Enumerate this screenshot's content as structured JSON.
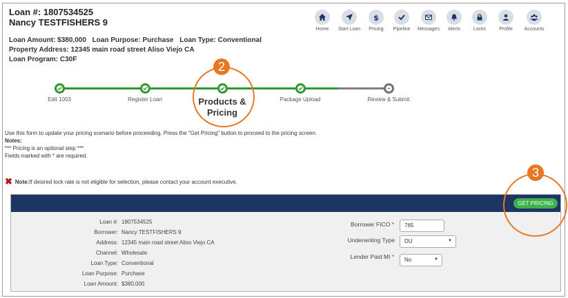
{
  "loan": {
    "number_line": "Loan #: 1807534525",
    "borrower_line": "Nancy TESTFISHERS 9",
    "amount_label": "Loan Amount: $380,000",
    "purpose_label": "Loan Purpose: Purchase",
    "type_label": "Loan Type: Conventional",
    "address_label": "Property Address: 12345 main road street Aliso Viejo CA",
    "program_label": "Loan Program: C30F"
  },
  "nav": [
    {
      "label": "Home",
      "icon": "home-icon"
    },
    {
      "label": "Start Loan",
      "icon": "arrow-icon"
    },
    {
      "label": "Pricing",
      "icon": "dollar-icon"
    },
    {
      "label": "Pipeline",
      "icon": "check-icon"
    },
    {
      "label": "Messages",
      "icon": "envelope-icon"
    },
    {
      "label": "Alerts",
      "icon": "bell-icon"
    },
    {
      "label": "Locks",
      "icon": "lock-icon"
    },
    {
      "label": "Profile",
      "icon": "user-icon"
    },
    {
      "label": "Accounts",
      "icon": "users-icon"
    }
  ],
  "steps": [
    {
      "label": "Edit 1003",
      "status": "complete"
    },
    {
      "label": "Register Loan",
      "status": "complete"
    },
    {
      "label": "Products & Pricing",
      "status": "current"
    },
    {
      "label": "Package Upload",
      "status": "complete"
    },
    {
      "label": "Review & Submit",
      "status": "pending"
    }
  ],
  "annotations": {
    "badge_2": "2",
    "badge_3": "3"
  },
  "info": {
    "instruction": "Use this form to update your pricing scenario before proceeding. Press the \"Get Pricing\" button to proceed to the pricing screen.",
    "notes_label": "Notes:",
    "note1": "*** Pricing is an optional step ***",
    "note2": "Fields marked with  *  are required."
  },
  "lock_note": {
    "bold": "Note:",
    "text": " If desired lock rate is not eligible for selection, please contact your account executive."
  },
  "panel": {
    "get_pricing_label": "GET PRICING",
    "details": [
      {
        "label": "Loan #:",
        "value": "1807534525"
      },
      {
        "label": "Borrower:",
        "value": "Nancy TESTFISHERS 9"
      },
      {
        "label": "Address:",
        "value": "12345 main road street Aliso Viejo CA"
      },
      {
        "label": "Channel:",
        "value": "Wholesale"
      },
      {
        "label": "Loan Type:",
        "value": "Conventional"
      },
      {
        "label": "Loan Purpose:",
        "value": "Purchase"
      },
      {
        "label": "Loan Amount:",
        "value": "$380,000"
      }
    ],
    "fico_label": "Borrower FICO",
    "fico_value": "765",
    "underwriting_label": "Underwriting Type",
    "underwriting_value": "DU",
    "lender_mi_label": "Lender Paid MI",
    "lender_mi_value": "No"
  },
  "colors": {
    "accent_green": "#2e9a2e",
    "header_navy": "#1c3563",
    "annotation_orange": "#e87722",
    "button_green": "#3cb04a"
  }
}
